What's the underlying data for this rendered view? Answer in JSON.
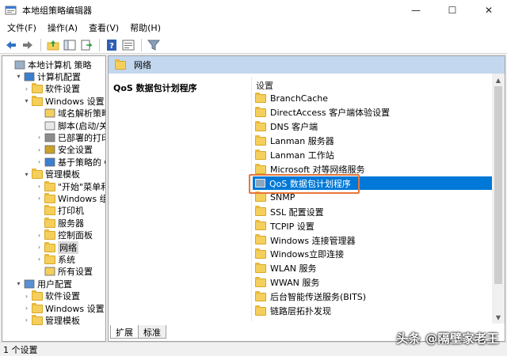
{
  "window": {
    "title": "本地组策略编辑器",
    "controls": {
      "minimize": "—",
      "maximize": "☐",
      "close": "✕"
    }
  },
  "menu": [
    "文件(F)",
    "操作(A)",
    "查看(V)",
    "帮助(H)"
  ],
  "toolbar": {
    "icons": [
      "back-arrow-icon",
      "forward-arrow-icon",
      "up-folder-icon",
      "show-hide-tree-icon",
      "export-list-icon",
      "help-icon",
      "properties-icon",
      "filter-icon"
    ]
  },
  "tree": {
    "items": [
      {
        "label": "本地计算机 策略",
        "level": 0,
        "expander": "",
        "icon": "computer-policy-icon"
      },
      {
        "label": "计算机配置",
        "level": 1,
        "expander": "▾",
        "icon": "computer-icon"
      },
      {
        "label": "软件设置",
        "level": 2,
        "expander": "›",
        "icon": "folder-icon"
      },
      {
        "label": "Windows 设置",
        "level": 2,
        "expander": "▾",
        "icon": "folder-icon"
      },
      {
        "label": "域名解析策略",
        "level": 3,
        "expander": "",
        "icon": "doc-folder-icon"
      },
      {
        "label": "脚本(启动/关",
        "level": 3,
        "expander": "",
        "icon": "script-icon"
      },
      {
        "label": "已部署的打印",
        "level": 3,
        "expander": "›",
        "icon": "printer-icon"
      },
      {
        "label": "安全设置",
        "level": 3,
        "expander": "›",
        "icon": "security-icon"
      },
      {
        "label": "基于策略的 Q",
        "level": 3,
        "expander": "›",
        "icon": "chart-icon"
      },
      {
        "label": "管理模板",
        "level": 2,
        "expander": "▾",
        "icon": "folder-icon"
      },
      {
        "label": "\"开始\"菜单和任",
        "level": 3,
        "expander": "›",
        "icon": "folder-icon"
      },
      {
        "label": "Windows 组件",
        "level": 3,
        "expander": "›",
        "icon": "folder-icon"
      },
      {
        "label": "打印机",
        "level": 3,
        "expander": "",
        "icon": "folder-icon"
      },
      {
        "label": "服务器",
        "level": 3,
        "expander": "",
        "icon": "folder-icon"
      },
      {
        "label": "控制面板",
        "level": 3,
        "expander": "›",
        "icon": "folder-icon"
      },
      {
        "label": "网络",
        "level": 3,
        "expander": "›",
        "icon": "folder-icon",
        "selected": true
      },
      {
        "label": "系统",
        "level": 3,
        "expander": "›",
        "icon": "folder-icon"
      },
      {
        "label": "所有设置",
        "level": 3,
        "expander": "",
        "icon": "all-settings-icon"
      },
      {
        "label": "用户配置",
        "level": 1,
        "expander": "▾",
        "icon": "user-icon"
      },
      {
        "label": "软件设置",
        "level": 2,
        "expander": "›",
        "icon": "folder-icon"
      },
      {
        "label": "Windows 设置",
        "level": 2,
        "expander": "›",
        "icon": "folder-icon"
      },
      {
        "label": "管理模板",
        "level": 2,
        "expander": "›",
        "icon": "folder-icon"
      }
    ]
  },
  "main": {
    "header": "网络",
    "description_title": "QoS 数据包计划程序",
    "column_header": "设置",
    "items": [
      {
        "label": "BranchCache"
      },
      {
        "label": "DirectAccess 客户端体验设置"
      },
      {
        "label": "DNS 客户端"
      },
      {
        "label": "Lanman 服务器"
      },
      {
        "label": "Lanman 工作站"
      },
      {
        "label": "Microsoft 对等网络服务"
      },
      {
        "label": "QoS 数据包计划程序",
        "selected": true
      },
      {
        "label": "SNMP"
      },
      {
        "label": "SSL 配置设置"
      },
      {
        "label": "TCPIP 设置"
      },
      {
        "label": "Windows 连接管理器"
      },
      {
        "label": "Windows立即连接"
      },
      {
        "label": "WLAN 服务"
      },
      {
        "label": "WWAN 服务"
      },
      {
        "label": "后台智能传送服务(BITS)"
      },
      {
        "label": "链路层拓扑发现"
      }
    ],
    "tabs": [
      "扩展",
      "标准"
    ],
    "active_tab": "扩展"
  },
  "status": {
    "text": "1 个设置"
  },
  "watermark": "头条 @隔壁家老王",
  "colors": {
    "selection": "#0078d7",
    "header_band": "#c3d7ee",
    "highlight_box": "#e8763b",
    "folder": "#f4cf5c"
  }
}
